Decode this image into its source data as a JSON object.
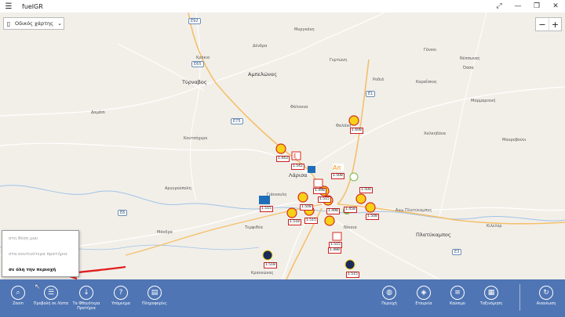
{
  "window": {
    "title": "fuelGR",
    "menu_glyph": "☰",
    "controls": {
      "expand": "⤢",
      "minimize": "—",
      "restore": "❐",
      "close": "✕"
    }
  },
  "map": {
    "type_label": "Οδικός χάρτης",
    "zoom_out": "−",
    "zoom_in": "+",
    "places": {
      "tyrnavos": "Τύρναβος",
      "ampelonas": "Αμπελώνας",
      "farsala_road": "Φάλαννα",
      "damasi": "Δαμάσι",
      "larisa": "Λάρισα",
      "mourgkani": "Μυργκάνη",
      "platykampos": "Πλατύκαμπος",
      "terpsithea": "Τερψιθέα",
      "mandra": "Μάνδρα",
      "koutsochero": "Κουτσόχερο",
      "argyropoli": "Αργυρούπολη",
      "ano_platykampos": "Άνω Πλατύκαμπος",
      "nessonas": "Νέσσωνας",
      "ossa": "Όσσα",
      "karaiskos": "Καραΐσκος",
      "marmariani": "Μαρμαριανή",
      "chalkidona": "Χαλκηδόνα",
      "gonnoi": "Γόννοι",
      "rodia": "Ροδιά",
      "dendra": "Δένδρα",
      "gyrtoni": "Γυρτώνη",
      "krokio": "Κρόκιο",
      "mavrovouni": "Μαυροβούνι",
      "kileler": "Κιλελέρ",
      "nikaia": "Νίκαια",
      "giannouli": "Γιάννουλη",
      "falani": "Φαλάνη",
      "krannonas": "Κραννώνας"
    },
    "shields": [
      "E92",
      "E65",
      "E75",
      "E1",
      "E3",
      "E6"
    ],
    "prices": [
      "1.508",
      "1.608",
      "1.443",
      "1.542",
      "1.515",
      "1.498",
      "1.508",
      "1.515",
      "1.458",
      "1.518",
      "1.515",
      "1.498",
      "1.508",
      "1.515",
      "1.488",
      "1.518",
      "1.515",
      "1.500"
    ]
  },
  "popup": {
    "items": [
      {
        "label": "στη θέση μου"
      },
      {
        "label": "στα κοντινότερα πρατήρια"
      },
      {
        "label": "σε όλη την περιοχή"
      }
    ]
  },
  "appbar": {
    "left": [
      {
        "label": "Zoom",
        "glyph": "⌕"
      },
      {
        "label": "Προβολή σε Λίστα",
        "glyph": "☰"
      },
      {
        "label": "Τα Φθηνότερα Πρατήρια",
        "glyph": "↓"
      },
      {
        "label": "Υπόμνημα",
        "glyph": "?"
      },
      {
        "label": "Πληροφορίες",
        "glyph": "▤"
      }
    ],
    "right": [
      {
        "label": "Περιοχή",
        "glyph": "◍"
      },
      {
        "label": "Εταιρεία",
        "glyph": "◈"
      },
      {
        "label": "Καύσιμο",
        "glyph": "≡"
      },
      {
        "label": "Ταξινόμηση",
        "glyph": "▦"
      },
      {
        "label": "Ανανέωση",
        "glyph": "↻"
      }
    ]
  },
  "colors": {
    "appbar": "#4f75b4",
    "map_bg": "#f2efe9",
    "road_major": "#f4c06b",
    "road_minor": "#ffffff",
    "arrow": "#e02020"
  }
}
